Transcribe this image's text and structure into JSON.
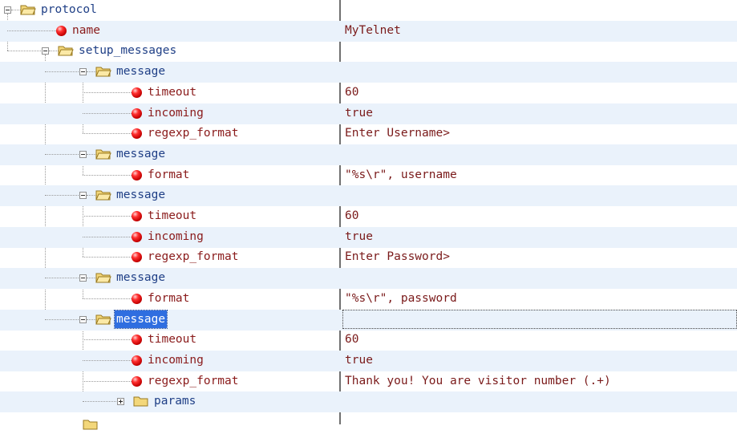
{
  "colors": {
    "folder_label": "#1f3f86",
    "leaf_label": "#8a1b1b",
    "selected_background": "#2f6ee0",
    "alternate_row": "#eaf2fb",
    "folder_icon": "#f3d77a",
    "ball_icon": "#e01010"
  },
  "tree": [
    {
      "type": "folder",
      "depth": 0,
      "label": "protocol",
      "expanded": true,
      "value": ""
    },
    {
      "type": "leaf",
      "depth": 1,
      "label": "name",
      "value": "MyTelnet",
      "icon": "red-ball-icon"
    },
    {
      "type": "folder",
      "depth": 1,
      "label": "setup_messages",
      "expanded": true,
      "value": ""
    },
    {
      "type": "folder",
      "depth": 2,
      "label": "message",
      "expanded": true,
      "value": ""
    },
    {
      "type": "leaf",
      "depth": 3,
      "label": "timeout",
      "value": "60",
      "icon": "red-ball-icon"
    },
    {
      "type": "leaf",
      "depth": 3,
      "label": "incoming",
      "value": "true",
      "icon": "red-ball-icon"
    },
    {
      "type": "leaf",
      "depth": 3,
      "label": "regexp_format",
      "value": "Enter Username>",
      "icon": "red-ball-icon"
    },
    {
      "type": "folder",
      "depth": 2,
      "label": "message",
      "expanded": true,
      "value": ""
    },
    {
      "type": "leaf",
      "depth": 3,
      "label": "format",
      "value": "\"%s\\r\", username",
      "icon": "red-ball-icon"
    },
    {
      "type": "folder",
      "depth": 2,
      "label": "message",
      "expanded": true,
      "value": ""
    },
    {
      "type": "leaf",
      "depth": 3,
      "label": "timeout",
      "value": "60",
      "icon": "red-ball-icon"
    },
    {
      "type": "leaf",
      "depth": 3,
      "label": "incoming",
      "value": "true",
      "icon": "red-ball-icon"
    },
    {
      "type": "leaf",
      "depth": 3,
      "label": "regexp_format",
      "value": "Enter Password>",
      "icon": "red-ball-icon"
    },
    {
      "type": "folder",
      "depth": 2,
      "label": "message",
      "expanded": true,
      "value": ""
    },
    {
      "type": "leaf",
      "depth": 3,
      "label": "format",
      "value": "\"%s\\r\", password",
      "icon": "red-ball-icon"
    },
    {
      "type": "folder",
      "depth": 2,
      "label": "message",
      "expanded": true,
      "selected": true,
      "value": ""
    },
    {
      "type": "leaf",
      "depth": 3,
      "label": "timeout",
      "value": "60",
      "icon": "red-ball-icon"
    },
    {
      "type": "leaf",
      "depth": 3,
      "label": "incoming",
      "value": "true",
      "icon": "red-ball-icon"
    },
    {
      "type": "leaf",
      "depth": 3,
      "label": "regexp_format",
      "value": "Thank you! You are visitor number (.+)",
      "icon": "red-ball-icon"
    },
    {
      "type": "folder",
      "depth": 3,
      "label": "params",
      "expanded": false,
      "value": ""
    }
  ]
}
